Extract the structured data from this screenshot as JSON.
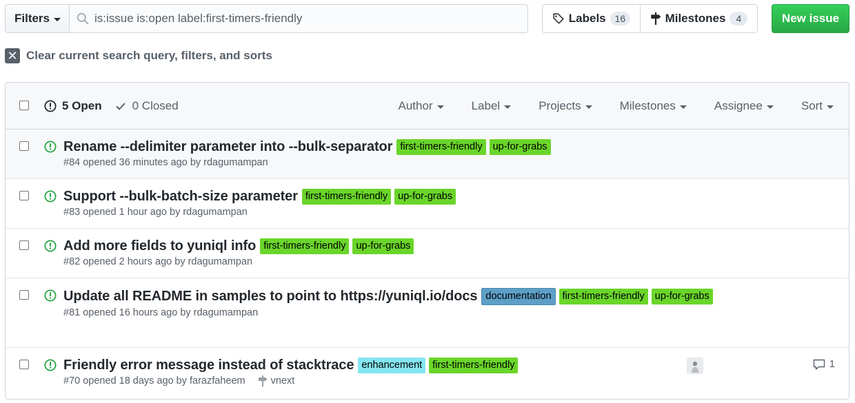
{
  "topbar": {
    "filters_label": "Filters",
    "search_value": "is:issue is:open label:first-timers-friendly",
    "labels_label": "Labels",
    "labels_count": "16",
    "milestones_label": "Milestones",
    "milestones_count": "4",
    "new_issue_label": "New issue"
  },
  "clear_filters_label": "Clear current search query, filters, and sorts",
  "header": {
    "open_label": "5 Open",
    "closed_label": "0 Closed",
    "filters": [
      "Author",
      "Label",
      "Projects",
      "Milestones",
      "Assignee",
      "Sort"
    ]
  },
  "colors": {
    "first-timers-friendly": "#6ad52a",
    "up-for-grabs": "#6ad52a",
    "documentation": "#5d9fc7",
    "enhancement": "#84e6f1",
    "open_icon": "#28a745"
  },
  "issues": [
    {
      "title": "Rename --delimiter parameter into --bulk-separator",
      "labels": [
        "first-timers-friendly",
        "up-for-grabs"
      ],
      "meta": "#84 opened 36 minutes ago by rdagumampan"
    },
    {
      "title": "Support --bulk-batch-size parameter",
      "labels": [
        "first-timers-friendly",
        "up-for-grabs"
      ],
      "meta": "#83 opened 1 hour ago by rdagumampan"
    },
    {
      "title": "Add more fields to yuniql info",
      "labels": [
        "first-timers-friendly",
        "up-for-grabs"
      ],
      "meta": "#82 opened 2 hours ago by rdagumampan"
    },
    {
      "title": "Update all README in samples to point to https://yuniql.io/docs",
      "labels": [
        "documentation",
        "first-timers-friendly",
        "up-for-grabs"
      ],
      "meta": "#81 opened 16 hours ago by rdagumampan"
    },
    {
      "title": "Friendly error message instead of stacktrace",
      "labels": [
        "enhancement",
        "first-timers-friendly"
      ],
      "meta": "#70 opened 18 days ago by farazfaheem",
      "milestone": "vnext",
      "comments": "1"
    }
  ]
}
